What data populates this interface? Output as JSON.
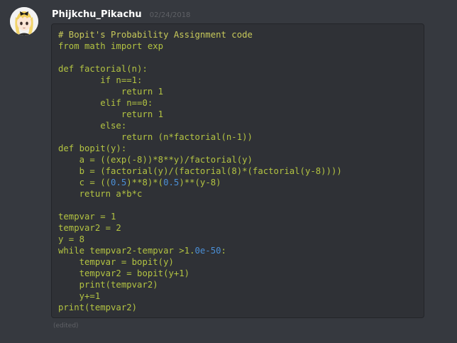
{
  "message": {
    "username": "Phijkchu_Pikachu",
    "timestamp": "02/24/2018",
    "edited_label": "(edited)",
    "avatar_icon": "anime-avatar-icon"
  },
  "colors": {
    "background": "#36393f",
    "codeblock_bg": "#2f3136",
    "comment": "#c7c95a",
    "keyword": "#b3c342",
    "plain": "#b8b9b6",
    "number": "#4b8fd6",
    "username": "#ffffff",
    "muted": "#5f6166"
  },
  "code": {
    "lines": [
      [
        {
          "t": "# Bopit's Probability Assignment code",
          "k": "comment"
        }
      ],
      [
        {
          "t": "from math import exp",
          "k": "keyword"
        }
      ],
      [],
      [
        {
          "t": "def factorial(n):",
          "k": "keyword"
        }
      ],
      [
        {
          "t": "        if n==1:",
          "k": "keyword"
        }
      ],
      [
        {
          "t": "            return 1",
          "k": "keyword"
        }
      ],
      [
        {
          "t": "        elif n==0:",
          "k": "keyword"
        }
      ],
      [
        {
          "t": "            return 1",
          "k": "keyword"
        }
      ],
      [
        {
          "t": "        else:",
          "k": "keyword"
        }
      ],
      [
        {
          "t": "            return (n*factorial(n-1))",
          "k": "keyword"
        }
      ],
      [
        {
          "t": "def bopit(y):",
          "k": "keyword"
        }
      ],
      [
        {
          "t": "    a = ",
          "k": "keyword"
        },
        {
          "t": "((exp(-8))*8**y)/factorial(y)",
          "k": "keyword"
        }
      ],
      [
        {
          "t": "    b = ",
          "k": "keyword"
        },
        {
          "t": "(factorial(y)/(factorial(8)*(factorial(y-8))))",
          "k": "keyword"
        }
      ],
      [
        {
          "t": "    c = ((",
          "k": "keyword"
        },
        {
          "t": "0.5",
          "k": "number"
        },
        {
          "t": ")**8)*(",
          "k": "keyword"
        },
        {
          "t": "0.5",
          "k": "number"
        },
        {
          "t": ")**(y-8)",
          "k": "keyword"
        }
      ],
      [
        {
          "t": "    return a*b*c",
          "k": "keyword"
        }
      ],
      [],
      [
        {
          "t": "tempvar = 1",
          "k": "keyword"
        }
      ],
      [
        {
          "t": "tempvar2 = 2",
          "k": "keyword"
        }
      ],
      [
        {
          "t": "y = 8",
          "k": "keyword"
        }
      ],
      [
        {
          "t": "while tempvar2-tempvar >1.",
          "k": "keyword"
        },
        {
          "t": "0e-50",
          "k": "number"
        },
        {
          "t": ":",
          "k": "keyword"
        }
      ],
      [
        {
          "t": "    tempvar = bopit(y)",
          "k": "keyword"
        }
      ],
      [
        {
          "t": "    tempvar2 = bopit(y+1)",
          "k": "keyword"
        }
      ],
      [
        {
          "t": "    print(tempvar2)",
          "k": "keyword"
        }
      ],
      [
        {
          "t": "    y+=1",
          "k": "keyword"
        }
      ],
      [
        {
          "t": "print(tempvar2)",
          "k": "keyword"
        }
      ]
    ]
  }
}
